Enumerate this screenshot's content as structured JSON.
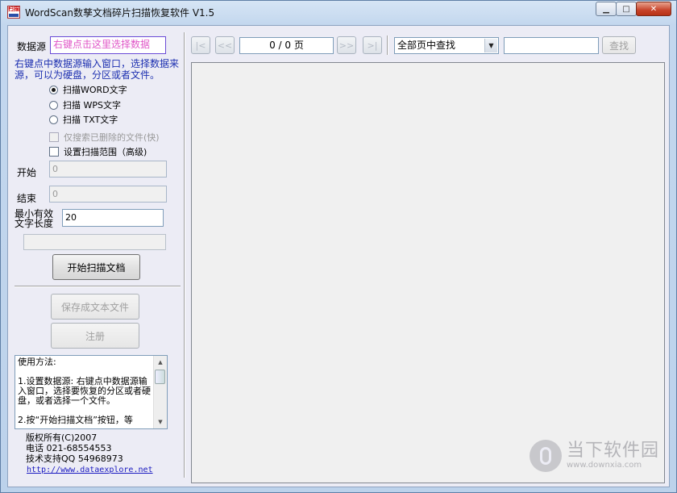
{
  "window": {
    "title": "WordScan数孳文档碎片扫描恢复软件 V1.5",
    "icon_text": "扫描",
    "minimize_glyph": "▁",
    "maximize_glyph": "□",
    "close_glyph": "✕"
  },
  "left_panel": {
    "source_label": "数据源",
    "source_field_value": "右键点击这里选择数据",
    "source_hint": "右键点中数据源输入窗口，选择数据来源，可以为硬盘，分区或者文件。",
    "radio_options": [
      {
        "label": "扫描WORD文字",
        "selected": true
      },
      {
        "label": "扫描 WPS文字",
        "selected": false
      },
      {
        "label": "扫描 TXT文字",
        "selected": false
      }
    ],
    "checkboxes": [
      {
        "label": "仅搜索已删除的文件(快)",
        "checked": false,
        "enabled": false
      },
      {
        "label": "设置扫描范围（高级)",
        "checked": false,
        "enabled": true
      }
    ],
    "start_label": "开始",
    "start_value": "0",
    "end_label": "结束",
    "end_value": "0",
    "min_length_label_line1": "最小有效",
    "min_length_label_line2": "文字长度",
    "min_length_value": "20",
    "progress_value": 0,
    "start_scan_button": "开始扫描文档",
    "save_text_button": "保存成文本文件",
    "register_button": "注册",
    "usage_text": "使用方法:\n\n1.设置数据源: 右键点中数据源输入窗口，选择要恢复的分区或者硬盘，或者选择一个文件。\n\n2.按“开始扫描文档”按钮，等",
    "copyright_line1": "版权所有(C)2007",
    "copyright_line2": "电话 021-68554553",
    "copyright_line3": "技术支持QQ 54968973",
    "website": "http://www.dataexplore.net"
  },
  "toolbar": {
    "first_glyph": "|<",
    "prev_glyph": "<<",
    "page_indicator": "0 / 0 页",
    "next_glyph": ">>",
    "last_glyph": ">|",
    "search_scope_selected": "全部页中查找",
    "search_value": "",
    "search_button": "查找"
  },
  "watermark": {
    "main": "当下软件园",
    "sub": "www.downxia.com"
  },
  "colors": {
    "hint_text": "#1c2fb0",
    "source_field_text": "#e056c7",
    "close_button": "#c7432a"
  }
}
